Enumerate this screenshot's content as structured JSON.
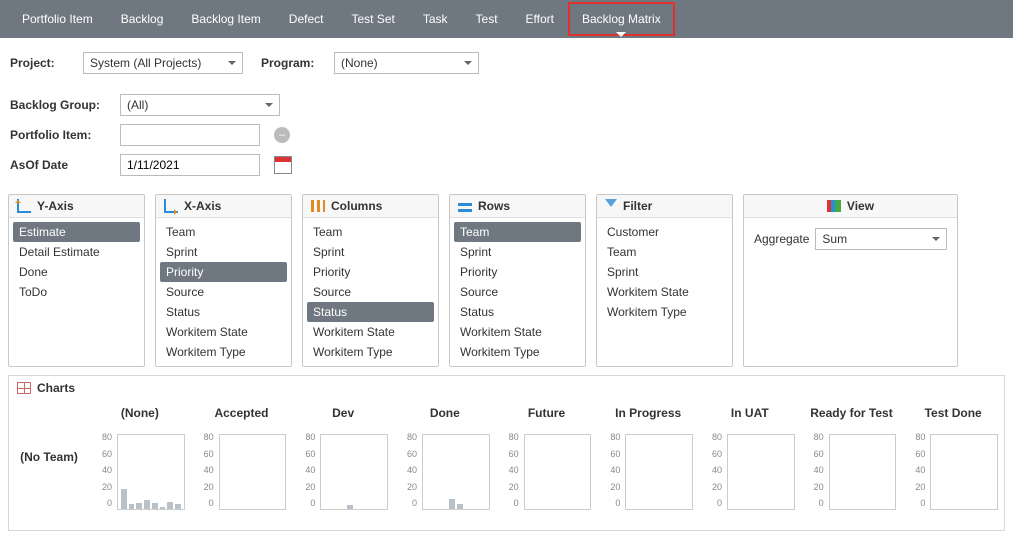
{
  "nav": {
    "tabs": [
      "Portfolio Item",
      "Backlog",
      "Backlog Item",
      "Defect",
      "Test Set",
      "Task",
      "Test",
      "Effort",
      "Backlog Matrix"
    ],
    "active_index": 8
  },
  "toolbar": {
    "project_label": "Project:",
    "project_value": "System (All Projects)",
    "program_label": "Program:",
    "program_value": "(None)"
  },
  "filters": {
    "backlog_group_label": "Backlog Group:",
    "backlog_group_value": "(All)",
    "portfolio_item_label": "Portfolio Item:",
    "portfolio_item_value": "",
    "asof_label": "AsOf Date",
    "asof_value": "1/11/2021"
  },
  "panels": {
    "yaxis": {
      "title": "Y-Axis",
      "options": [
        "Estimate",
        "Detail Estimate",
        "Done",
        "ToDo"
      ],
      "selected": 0
    },
    "xaxis": {
      "title": "X-Axis",
      "options": [
        "Team",
        "Sprint",
        "Priority",
        "Source",
        "Status",
        "Workitem State",
        "Workitem Type"
      ],
      "selected": 2
    },
    "columns": {
      "title": "Columns",
      "options": [
        "Team",
        "Sprint",
        "Priority",
        "Source",
        "Status",
        "Workitem State",
        "Workitem Type"
      ],
      "selected": 4
    },
    "rows": {
      "title": "Rows",
      "options": [
        "Team",
        "Sprint",
        "Priority",
        "Source",
        "Status",
        "Workitem State",
        "Workitem Type"
      ],
      "selected": 0
    },
    "filter": {
      "title": "Filter",
      "options": [
        "Customer",
        "Team",
        "Sprint",
        "Workitem State",
        "Workitem Type"
      ],
      "selected": -1
    },
    "view": {
      "title": "View",
      "aggregate_label": "Aggregate",
      "aggregate_value": "Sum"
    }
  },
  "charts": {
    "title": "Charts",
    "column_headers": [
      "(None)",
      "Accepted",
      "Dev",
      "Done",
      "Future",
      "In Progress",
      "In UAT",
      "Ready for Test",
      "Test Done"
    ],
    "row_headers": [
      "(No Team)"
    ],
    "y_ticks": [
      "80",
      "60",
      "40",
      "20",
      "0"
    ]
  },
  "chart_data": {
    "type": "bar",
    "xlabel": "Priority",
    "ylabel": "Estimate",
    "ylim": [
      0,
      80
    ],
    "grid": [
      {
        "row": "(No Team)",
        "col": "(None)",
        "values": [
          22,
          5,
          6,
          10,
          6,
          2,
          8,
          5
        ]
      },
      {
        "row": "(No Team)",
        "col": "Accepted",
        "values": [
          0,
          0,
          0,
          0,
          0,
          0,
          0,
          0
        ]
      },
      {
        "row": "(No Team)",
        "col": "Dev",
        "values": [
          0,
          0,
          0,
          4,
          0,
          0,
          0,
          0
        ]
      },
      {
        "row": "(No Team)",
        "col": "Done",
        "values": [
          0,
          0,
          0,
          11,
          5,
          0,
          0,
          0
        ]
      },
      {
        "row": "(No Team)",
        "col": "Future",
        "values": [
          0,
          0,
          0,
          0,
          0,
          0,
          0,
          0
        ]
      },
      {
        "row": "(No Team)",
        "col": "In Progress",
        "values": [
          0,
          0,
          0,
          0,
          0,
          0,
          0,
          0
        ]
      },
      {
        "row": "(No Team)",
        "col": "In UAT",
        "values": [
          0,
          0,
          0,
          0,
          0,
          0,
          0,
          0
        ]
      },
      {
        "row": "(No Team)",
        "col": "Ready for Test",
        "values": [
          0,
          0,
          0,
          0,
          0,
          0,
          0,
          0
        ]
      },
      {
        "row": "(No Team)",
        "col": "Test Done",
        "values": [
          0,
          0,
          0,
          0,
          0,
          0,
          0,
          0
        ]
      }
    ]
  }
}
